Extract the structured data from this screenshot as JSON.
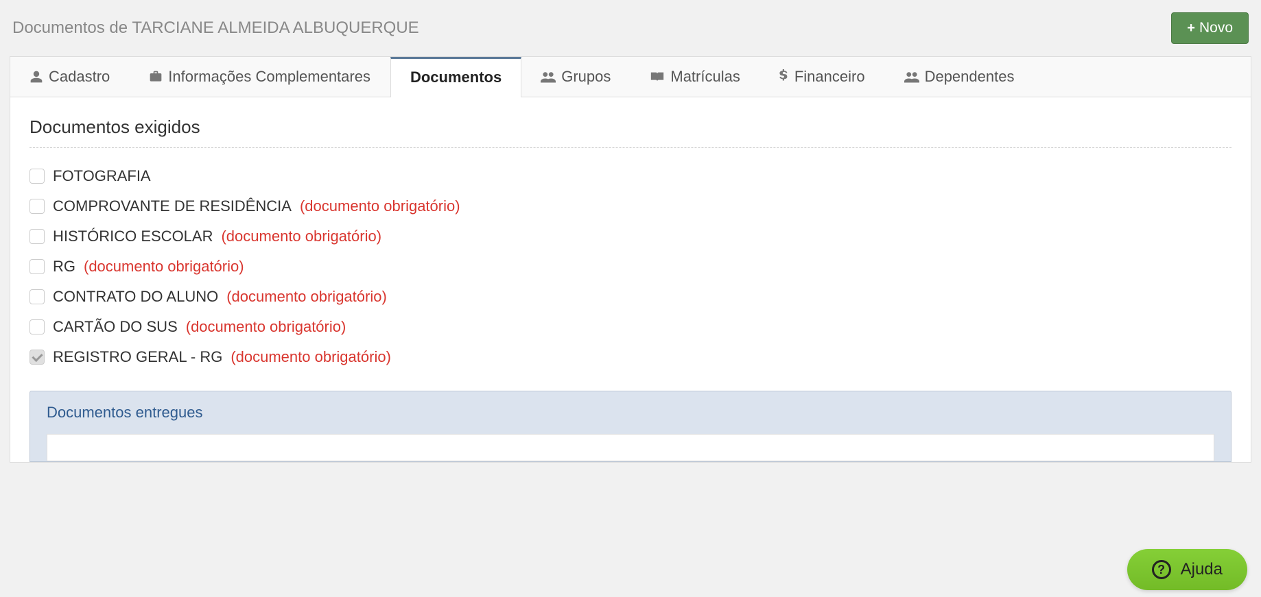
{
  "header": {
    "title": "Documentos de TARCIANE ALMEIDA ALBUQUERQUE",
    "new_button": "Novo"
  },
  "tabs": [
    {
      "label": "Cadastro",
      "icon": "user-icon",
      "active": false
    },
    {
      "label": "Informações Complementares",
      "icon": "briefcase-icon",
      "active": false
    },
    {
      "label": "Documentos",
      "icon": null,
      "active": true
    },
    {
      "label": "Grupos",
      "icon": "users-icon",
      "active": false
    },
    {
      "label": "Matrículas",
      "icon": "book-icon",
      "active": false
    },
    {
      "label": "Financeiro",
      "icon": "dollar-icon",
      "active": false
    },
    {
      "label": "Dependentes",
      "icon": "users-icon",
      "active": false
    }
  ],
  "section_heading": "Documentos exigidos",
  "required_note": "(documento obrigatório)",
  "documents": [
    {
      "label": "FOTOGRAFIA",
      "required": false,
      "checked": false
    },
    {
      "label": "COMPROVANTE DE RESIDÊNCIA",
      "required": true,
      "checked": false
    },
    {
      "label": "HISTÓRICO ESCOLAR",
      "required": true,
      "checked": false
    },
    {
      "label": "RG",
      "required": true,
      "checked": false
    },
    {
      "label": "CONTRATO DO ALUNO",
      "required": true,
      "checked": false
    },
    {
      "label": "CARTÃO DO SUS",
      "required": true,
      "checked": false
    },
    {
      "label": "REGISTRO GERAL - RG",
      "required": true,
      "checked": true
    }
  ],
  "delivered_heading": "Documentos entregues",
  "help_label": "Ajuda"
}
